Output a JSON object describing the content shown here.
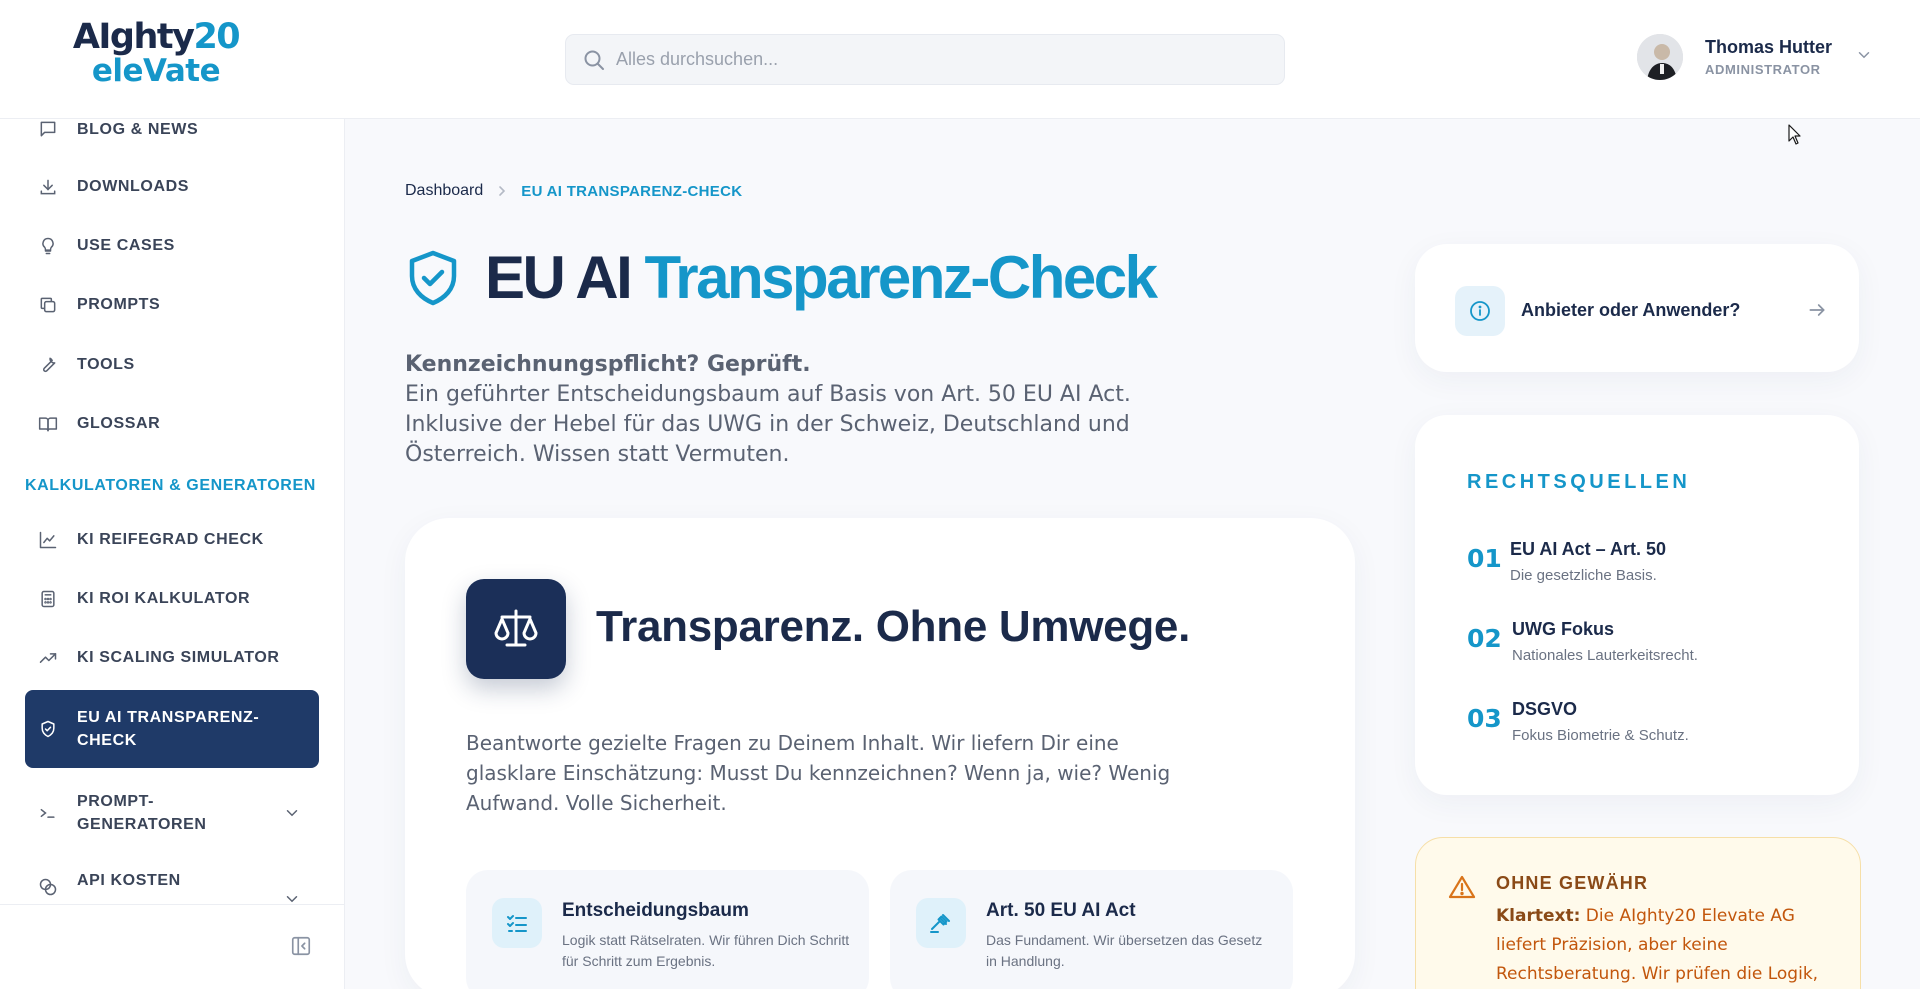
{
  "header": {
    "logo_line1_a": "AIghty",
    "logo_line1_b": "20",
    "logo_line2": "eleVate",
    "search_placeholder": "Alles durchsuchen...",
    "user_name": "Thomas Hutter",
    "user_role": "ADMINISTRATOR"
  },
  "sidebar": {
    "items": [
      {
        "label": "BLOG & NEWS",
        "icon": "message-icon"
      },
      {
        "label": "DOWNLOADS",
        "icon": "download-icon"
      },
      {
        "label": "USE CASES",
        "icon": "lightbulb-icon"
      },
      {
        "label": "PROMPTS",
        "icon": "copy-icon"
      },
      {
        "label": "TOOLS",
        "icon": "wrench-icon"
      },
      {
        "label": "GLOSSAR",
        "icon": "book-icon"
      }
    ],
    "section_title": "KALKULATOREN & GENERATOREN",
    "calc_items": [
      {
        "label": "KI REIFEGRAD CHECK",
        "icon": "line-chart-icon"
      },
      {
        "label": "KI ROI KALKULATOR",
        "icon": "calculator-icon"
      },
      {
        "label": "KI SCALING SIMULATOR",
        "icon": "trending-up-icon"
      },
      {
        "label": "EU AI TRANSPARENZ-CHECK",
        "icon": "shield-check-icon",
        "active": true
      },
      {
        "label": "PROMPT-GENERATOREN",
        "icon": "terminal-icon"
      },
      {
        "label": "API KOSTEN",
        "icon": "coins-icon"
      }
    ]
  },
  "breadcrumb": {
    "home": "Dashboard",
    "current": "EU AI TRANSPARENZ-CHECK"
  },
  "page": {
    "title_a": "EU AI",
    "title_b": "Transparenz-Check",
    "intro_bold": "Kennzeichnungspflicht? Geprüft.",
    "intro_text": "Ein geführter Entscheidungsbaum auf Basis von Art. 50 EU AI Act. Inklusive der Hebel für das UWG in der Schweiz, Deutschland und Österreich. Wissen statt Vermuten."
  },
  "main_card": {
    "title": "Transparenz. Ohne Umwege.",
    "description": "Beantworte gezielte Fragen zu Deinem Inhalt. Wir liefern Dir eine glasklare Einschätzung: Musst Du kennzeichnen? Wenn ja, wie? Wenig Aufwand. Volle Sicherheit.",
    "features": [
      {
        "title": "Entscheidungsbaum",
        "desc": "Logik statt Rätselraten. Wir führen Dich Schritt für Schritt zum Ergebnis."
      },
      {
        "title": "Art. 50 EU AI Act",
        "desc": "Das Fundament. Wir übersetzen das Gesetz in Handlung."
      }
    ]
  },
  "question_card": {
    "label": "Anbieter oder Anwender?"
  },
  "sources": {
    "title": "RECHTSQUELLEN",
    "items": [
      {
        "num": "01",
        "name": "EU AI Act – Art. 50",
        "desc": "Die gesetzliche Basis."
      },
      {
        "num": "02",
        "name": "UWG Fokus",
        "desc": "Nationales Lauterkeitsrecht."
      },
      {
        "num": "03",
        "name": "DSGVO",
        "desc": "Fokus Biometrie & Schutz."
      }
    ]
  },
  "warning": {
    "title": "OHNE GEWÄHR",
    "lead": "Klartext:",
    "text": " Die AIghty20 Elevate AG liefert Präzision, aber keine Rechtsberatung. Wir prüfen die Logik, Du trägst die"
  },
  "colors": {
    "accent": "#1596c9",
    "navy": "#1b2a4a",
    "active_nav": "#1f3a68",
    "warning_bg": "#fffaeb",
    "warning_text": "#c2560c"
  }
}
